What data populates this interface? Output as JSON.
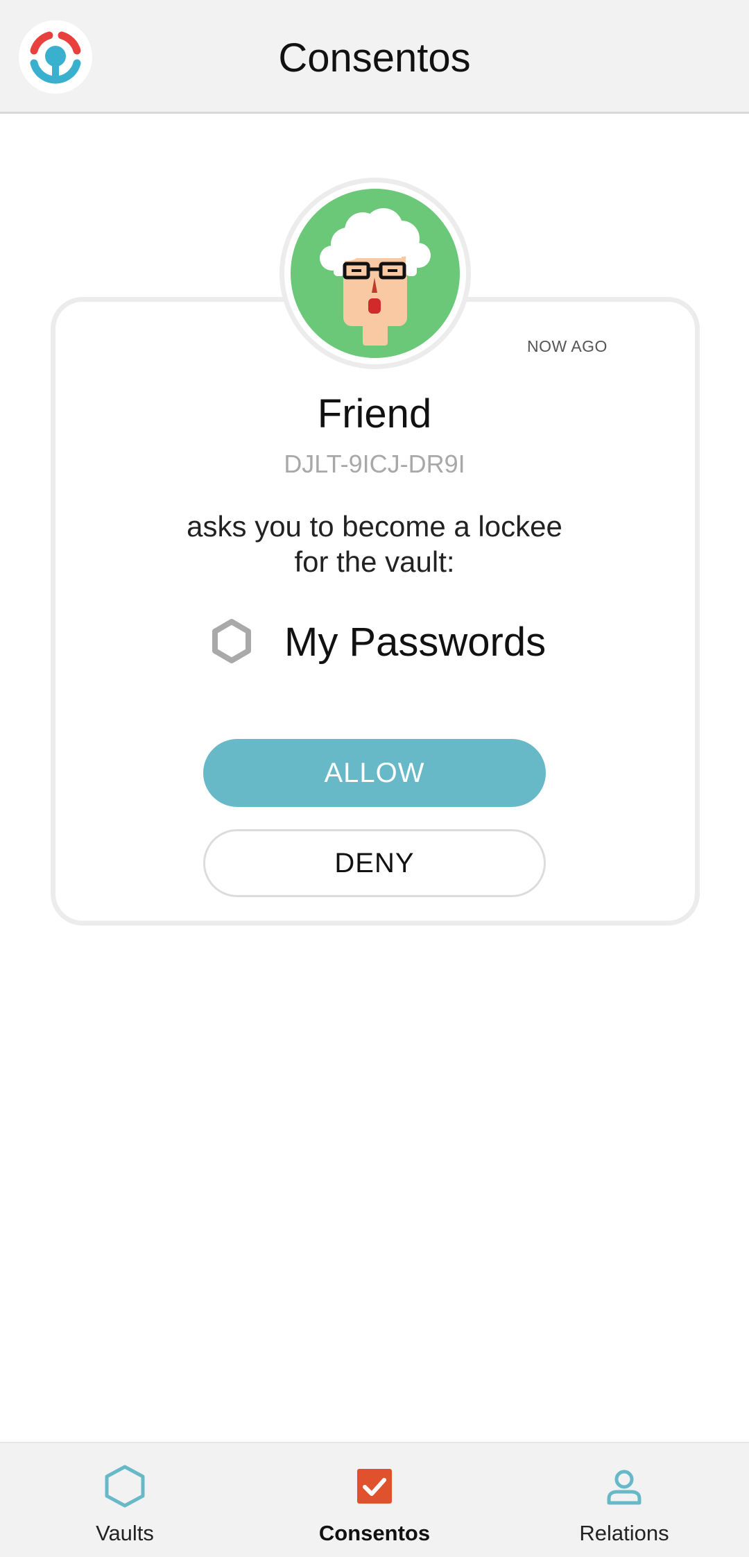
{
  "header": {
    "title": "Consentos",
    "logo_icon": "lifebuoy-logo-icon"
  },
  "request": {
    "timestamp": "NOW AGO",
    "friend_name": "Friend",
    "friend_id": "DJLT-9ICJ-DR9I",
    "message": "asks you to become a lockee for the vault:",
    "vault_name": "My Passwords",
    "vault_icon": "hexagon-icon",
    "avatar_icon": "elderly-person-avatar",
    "allow_label": "ALLOW",
    "deny_label": "DENY"
  },
  "nav": {
    "items": [
      {
        "label": "Vaults",
        "icon": "hexagon-icon",
        "active": false
      },
      {
        "label": "Consentos",
        "icon": "checkbox-icon",
        "active": true
      },
      {
        "label": "Relations",
        "icon": "person-icon",
        "active": false
      }
    ]
  },
  "colors": {
    "accent": "#67b9c8",
    "avatar_bg": "#6cc879",
    "consentos_icon": "#e0522e",
    "logo_red": "#e8413d",
    "logo_blue": "#3ab0cf"
  }
}
